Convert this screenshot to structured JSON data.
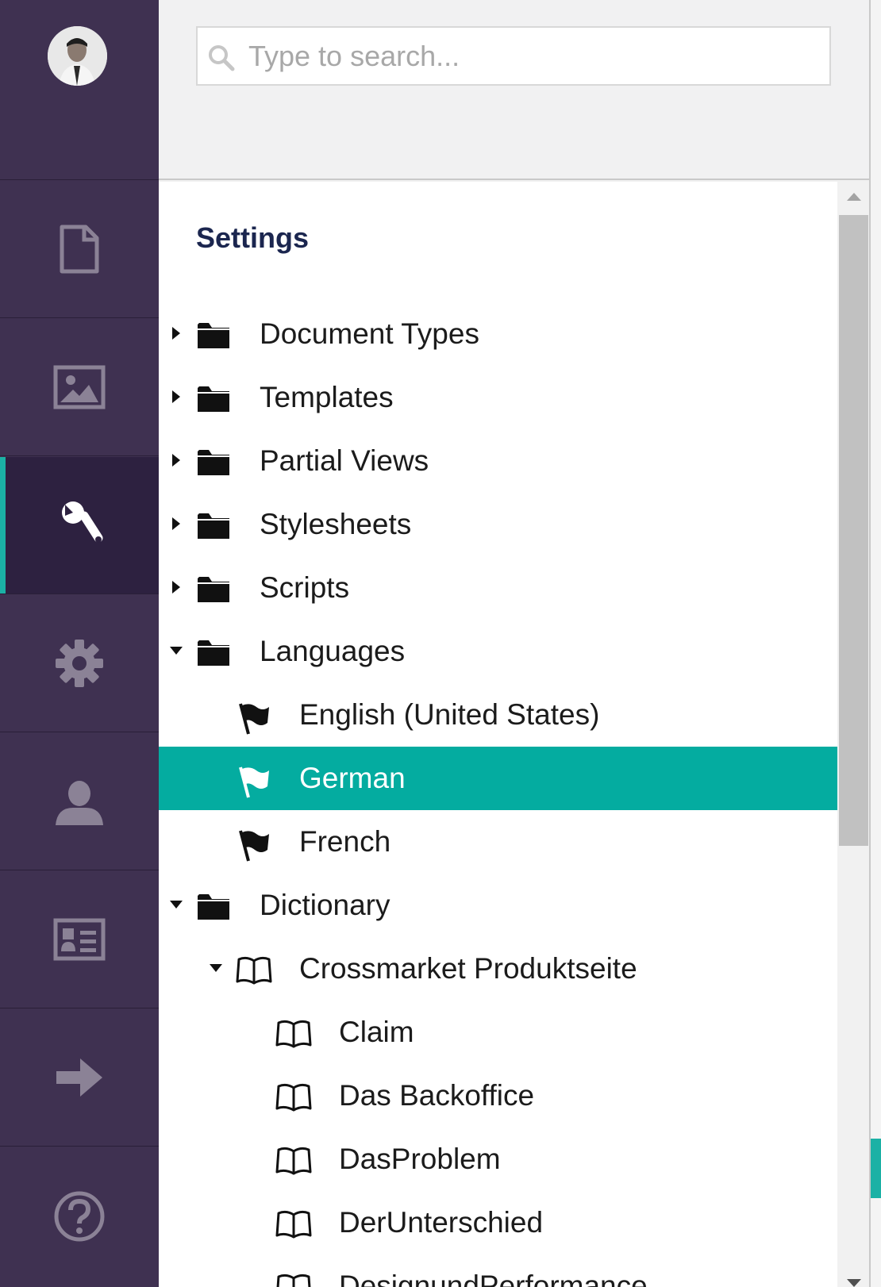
{
  "search": {
    "placeholder": "Type to search..."
  },
  "sidebar": {
    "items": [
      {
        "icon": "document-icon",
        "name": "content"
      },
      {
        "icon": "image-icon",
        "name": "media"
      },
      {
        "icon": "wrench-icon",
        "name": "settings",
        "active": true
      },
      {
        "icon": "gear-icon",
        "name": "developer"
      },
      {
        "icon": "user-icon",
        "name": "users"
      },
      {
        "icon": "id-card-icon",
        "name": "members"
      },
      {
        "icon": "arrow-right-icon",
        "name": "forms"
      },
      {
        "icon": "help-icon",
        "name": "help"
      }
    ]
  },
  "tree": {
    "title": "Settings",
    "nodes": [
      {
        "label": "Document Types",
        "icon": "folder-icon",
        "expanded": false
      },
      {
        "label": "Templates",
        "icon": "folder-icon",
        "expanded": false
      },
      {
        "label": "Partial Views",
        "icon": "folder-icon",
        "expanded": false
      },
      {
        "label": "Stylesheets",
        "icon": "folder-icon",
        "expanded": false
      },
      {
        "label": "Scripts",
        "icon": "folder-icon",
        "expanded": false
      },
      {
        "label": "Languages",
        "icon": "folder-icon",
        "expanded": true
      },
      {
        "label": "English (United States)",
        "icon": "flag-icon"
      },
      {
        "label": "German",
        "icon": "flag-icon",
        "selected": true
      },
      {
        "label": "French",
        "icon": "flag-icon"
      },
      {
        "label": "Dictionary",
        "icon": "folder-icon",
        "expanded": true
      },
      {
        "label": "Crossmarket Produktseite",
        "icon": "book-icon",
        "expanded": true
      },
      {
        "label": "Claim",
        "icon": "book-icon"
      },
      {
        "label": "Das Backoffice",
        "icon": "book-icon"
      },
      {
        "label": "DasProblem",
        "icon": "book-icon"
      },
      {
        "label": "DerUnterschied",
        "icon": "book-icon"
      },
      {
        "label": "DesignundPerformance",
        "icon": "book-icon"
      }
    ]
  },
  "colors": {
    "sidebar_bg": "#3f3151",
    "sidebar_active_bg": "#2d2140",
    "accent": "#1bb1a5",
    "selected_row": "#04aca0",
    "title_color": "#1b264f"
  }
}
